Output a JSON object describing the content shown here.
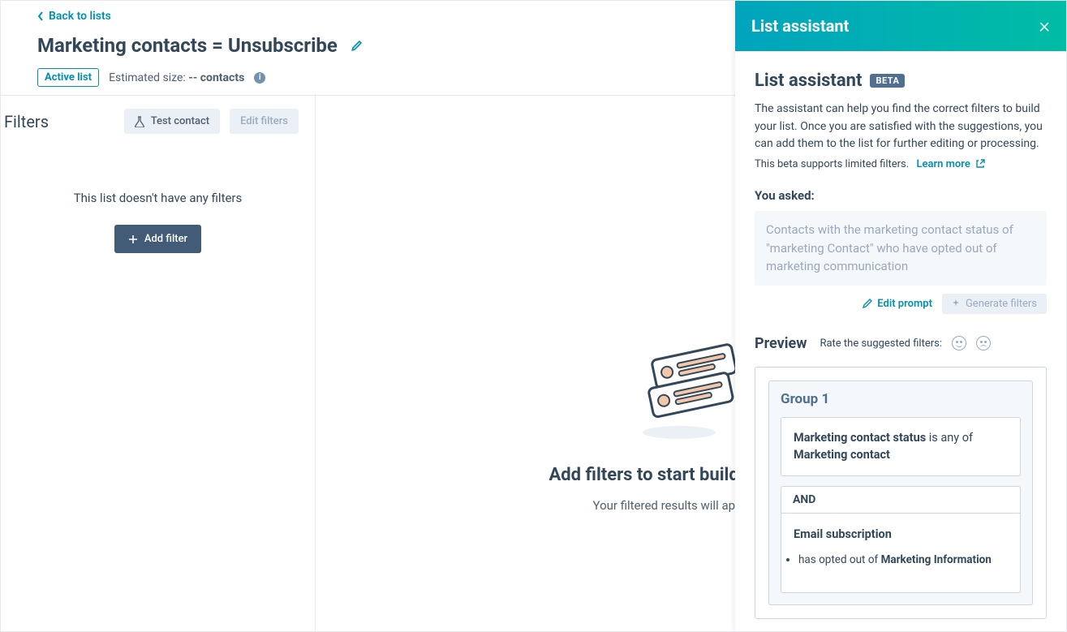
{
  "header": {
    "back_link": "Back to lists",
    "title": "Marketing contacts = Unsubscribe",
    "badge": "Active list",
    "estimated_label": "Estimated size: ",
    "estimated_value": "-- contacts"
  },
  "sidebar": {
    "title": "Filters",
    "test_contact": "Test contact",
    "edit_filters": "Edit filters",
    "empty_message": "This list doesn't have any filters",
    "add_filter": "Add filter"
  },
  "content": {
    "heading": "Add filters to start building your list",
    "subtext": "Your filtered results will appear here."
  },
  "panel": {
    "header_title": "List assistant",
    "body_title": "List assistant",
    "beta_badge": "BETA",
    "description": "The assistant can help you find the correct filters to build your list. Once you are satisfied with the suggestions, you can add them to the list for further editing or processing.",
    "beta_note": "This beta supports limited filters.",
    "learn_more": "Learn more",
    "you_asked_label": "You asked:",
    "prompt_text": "Contacts with the marketing contact status of \"marketing Contact\" who have opted out of marketing communication",
    "edit_prompt": "Edit prompt",
    "generate_filters": "Generate filters",
    "preview_title": "Preview",
    "rate_label": "Rate the suggested filters:",
    "group": {
      "title": "Group 1",
      "condition1": {
        "property": "Marketing contact status",
        "operator": " is any of ",
        "value": "Marketing contact"
      },
      "join": "AND",
      "condition2": {
        "property": "Email subscription",
        "sub_prefix": "has opted out of ",
        "sub_value": "Marketing Information"
      }
    }
  }
}
